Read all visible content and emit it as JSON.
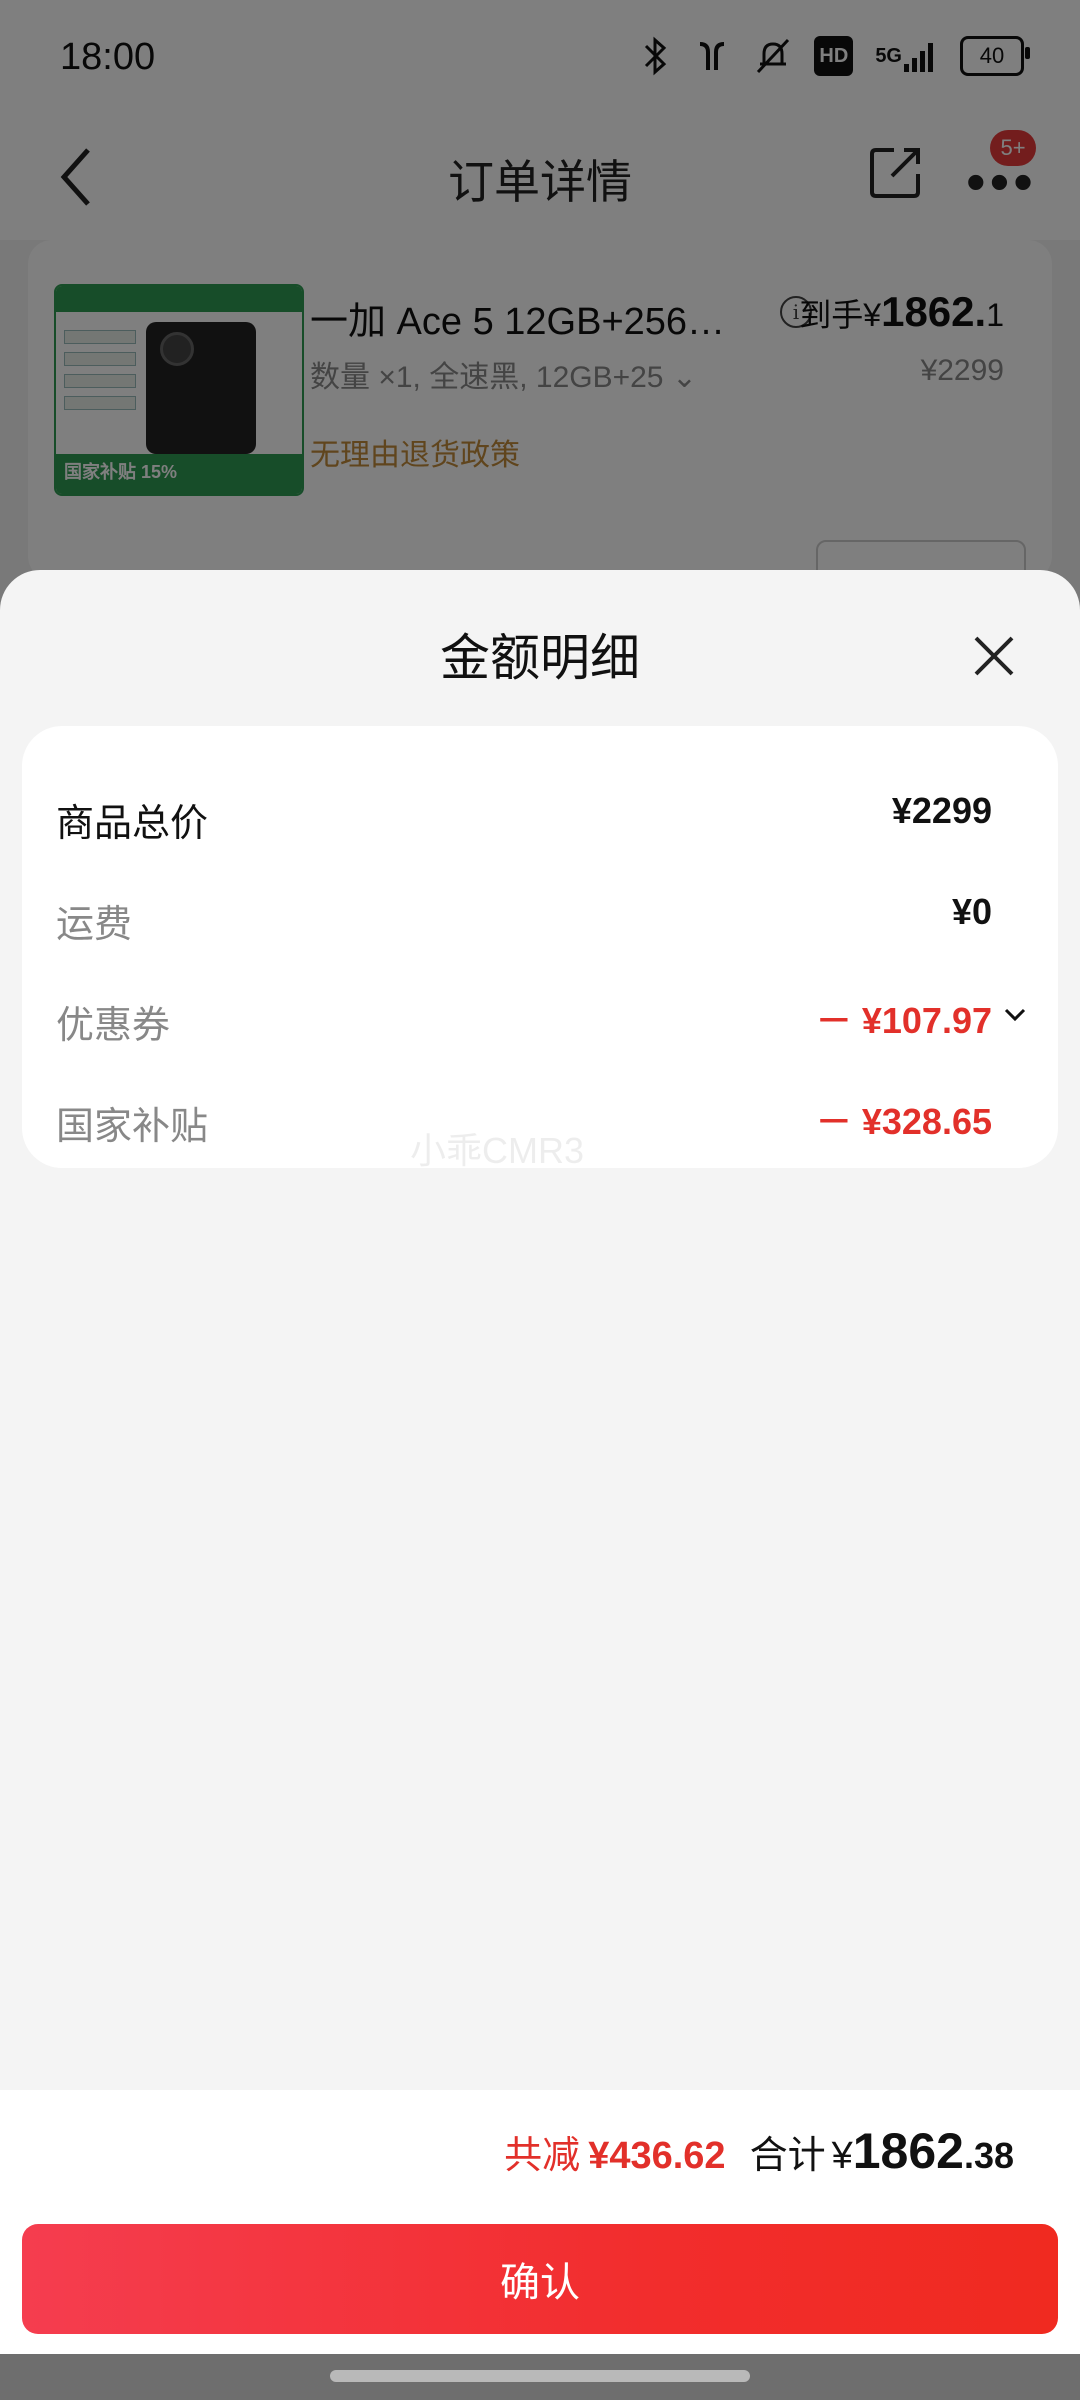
{
  "status_bar": {
    "time": "18:00",
    "hd_label": "HD",
    "network_label": "5G",
    "battery": "40",
    "icons": [
      "bluetooth-icon",
      "earbuds-icon",
      "mute-bell-icon",
      "hd-icon",
      "signal-icon",
      "battery-icon"
    ]
  },
  "nav": {
    "title": "订单详情",
    "back_icon": "back-chevron-icon",
    "share_icon": "share-icon",
    "more_icon": "more-icon",
    "badge": "5+"
  },
  "product": {
    "name": "一加 Ace 5 12GB+256…",
    "spec": "数量 ×1, 全速黑, 12GB+25 ⌄",
    "policy": "无理由退货政策",
    "final_prefix": "到手¥",
    "final_price_int": "1862.",
    "final_price_dec": "1",
    "original_price": "¥2299",
    "image_band_text": "国家补贴 15%"
  },
  "sheet": {
    "title": "金额明细",
    "rows": [
      {
        "label": "商品总价",
        "value": "¥2299"
      },
      {
        "label": "运费",
        "value": "¥0"
      },
      {
        "label": "优惠券",
        "value": "－ ¥107.97"
      },
      {
        "label": "国家补贴",
        "value": "－ ¥328.65"
      }
    ],
    "watermark": "小乖CMR3"
  },
  "footer": {
    "saved_label": "共减",
    "saved_amount": "¥436.62",
    "total_label": "合计",
    "total_currency": "¥",
    "total_int": "1862",
    "total_dec": ".38",
    "confirm_label": "确认"
  },
  "colors": {
    "accent_red": "#e2302a",
    "button_gradient_start": "#f53d4f",
    "button_gradient_end": "#f02a20"
  }
}
